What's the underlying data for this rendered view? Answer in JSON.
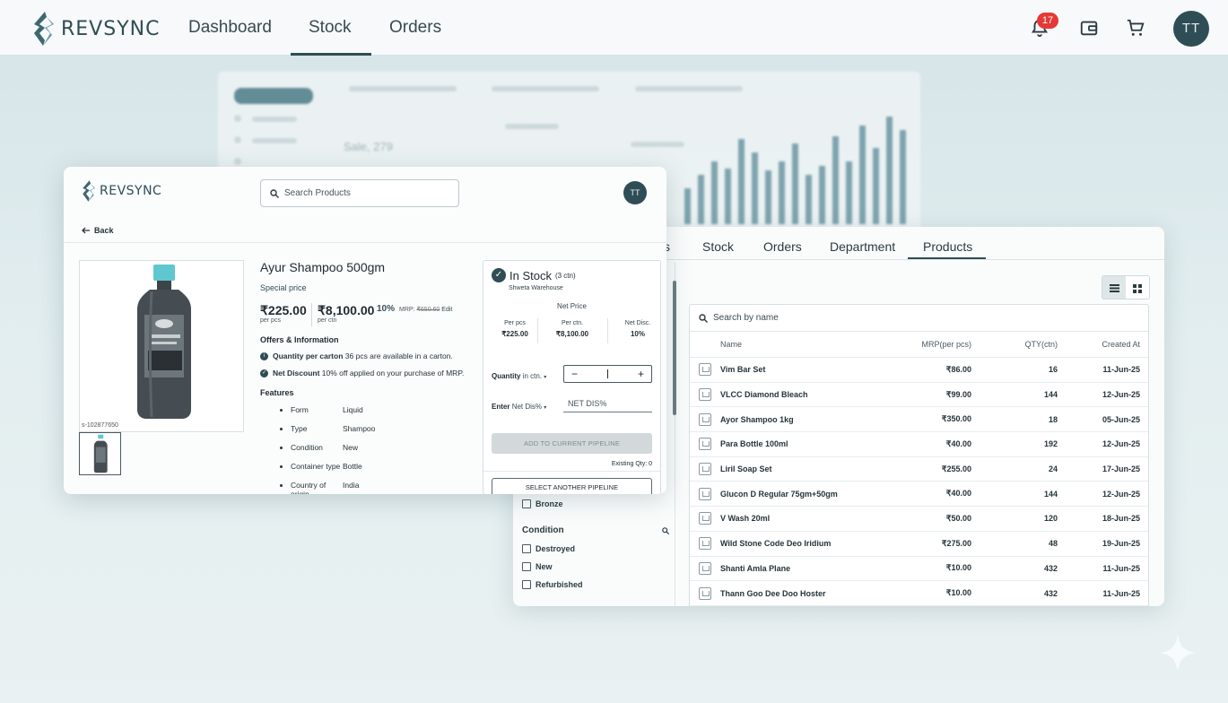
{
  "app": {
    "brand": "REVSYNC",
    "nav_tabs": [
      "Dashboard",
      "Stock",
      "Orders"
    ],
    "active_tab": "Stock",
    "notifications_count": "17",
    "user_initials": "TT"
  },
  "list_card": {
    "tabs": [
      "s",
      "Stock",
      "Orders",
      "Department",
      "Products"
    ],
    "active_tab": "Products",
    "search_placeholder": "Search by name",
    "columns": [
      "Name",
      "MRP(per pcs)",
      "QTY(ctn)",
      "Created At"
    ],
    "rows": [
      {
        "name": "Vim Bar Set",
        "mrp": "₹86.00",
        "qty": "16",
        "created": "11-Jun-25"
      },
      {
        "name": "VLCC Diamond Bleach",
        "mrp": "₹99.00",
        "qty": "144",
        "created": "12-Jun-25"
      },
      {
        "name": "Ayor Shampoo 1kg",
        "mrp": "₹350.00",
        "qty": "18",
        "created": "05-Jun-25"
      },
      {
        "name": "Para Bottle 100ml",
        "mrp": "₹40.00",
        "qty": "192",
        "created": "12-Jun-25"
      },
      {
        "name": "Liril Soap Set",
        "mrp": "₹255.00",
        "qty": "24",
        "created": "17-Jun-25"
      },
      {
        "name": "Glucon D Regular 75gm+50gm",
        "mrp": "₹40.00",
        "qty": "144",
        "created": "12-Jun-25"
      },
      {
        "name": "V Wash 20ml",
        "mrp": "₹50.00",
        "qty": "120",
        "created": "18-Jun-25"
      },
      {
        "name": "Wild Stone Code Deo Iridium",
        "mrp": "₹275.00",
        "qty": "48",
        "created": "19-Jun-25"
      },
      {
        "name": "Shanti Amla Plane",
        "mrp": "₹10.00",
        "qty": "432",
        "created": "11-Jun-25"
      },
      {
        "name": "Thann Goo Dee Doo Hoster",
        "mrp": "₹10.00",
        "qty": "432",
        "created": "11-Jun-25"
      }
    ],
    "filters": {
      "prev_option": "Bronze",
      "condition_title": "Condition",
      "condition_options": [
        "Destroyed",
        "New",
        "Refurbished"
      ]
    }
  },
  "product_card": {
    "brand": "REVSYNC",
    "search_placeholder": "Search Products",
    "user_initials": "TT",
    "back_label": "Back",
    "sku": "s-102877650",
    "title": "Ayur Shampoo 500gm",
    "special_label": "Special price",
    "price_pcs": "₹225.00",
    "price_pcs_unit": "per pcs",
    "price_ctn": "₹8,100.00",
    "price_ctn_unit": "per ctn",
    "discount": "10%",
    "mrp_prefix": "MRP:",
    "mrp_value": "₹650.60",
    "edit_label": "Edit",
    "offers_title": "Offers & Information",
    "offer1_bold": "Quantity per carton",
    "offer1_text": "36 pcs are available in a carton.",
    "offer2_bold": "Net Discount",
    "offer2_text": "10% off applied on your purchase of MRP.",
    "features_title": "Features",
    "features": [
      {
        "k": "Form",
        "v": "Liquid"
      },
      {
        "k": "Type",
        "v": "Shampoo"
      },
      {
        "k": "Condition",
        "v": "New"
      },
      {
        "k": "Container type",
        "v": "Bottle"
      },
      {
        "k": "Country of origin",
        "v": "India"
      }
    ],
    "stock": {
      "status": "In Stock",
      "status_qty": "(3 ctn)",
      "warehouse": "Shweta Warehouse",
      "net_price_label": "Net Price",
      "per_pcs_label": "Per pcs",
      "per_pcs_value": "₹225.00",
      "per_ctn_label": "Per ctn.",
      "per_ctn_value": "₹8,100.00",
      "net_disc_label": "Net Disc.",
      "net_disc_value": "10%",
      "quantity_label": "Quantity",
      "quantity_unit": "in ctn.",
      "disc_label": "Enter",
      "disc_unit": "Net Dis%",
      "disc_placeholder": "NET DIS%",
      "add_button": "ADD TO CURRENT PIPELINE",
      "existing_qty": "Existing Qty: 0",
      "select_button": "SELECT ANOTHER PIPELINE"
    }
  },
  "ghost_dashboard": {
    "sales_text": "Sale, 279"
  },
  "colors": {
    "brand": "#2f4d55",
    "badge": "#e53935",
    "background": "#dfe9ec"
  }
}
